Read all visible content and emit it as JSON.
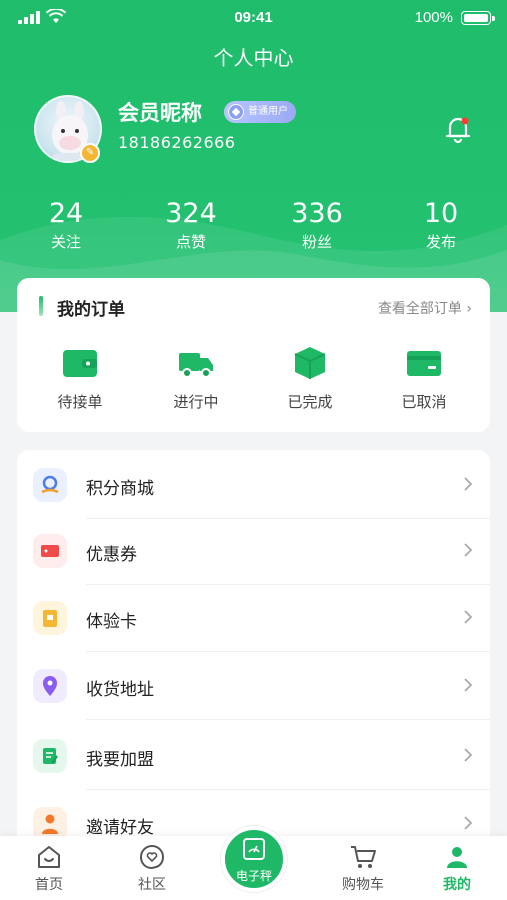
{
  "status_bar": {
    "time": "09:41",
    "battery": "100%"
  },
  "header": {
    "title": "个人中心"
  },
  "profile": {
    "nickname": "会员昵称",
    "badge": "普通用户",
    "phone": "18186262666"
  },
  "stats": [
    {
      "value": "24",
      "label": "关注"
    },
    {
      "value": "324",
      "label": "点赞"
    },
    {
      "value": "336",
      "label": "粉丝"
    },
    {
      "value": "10",
      "label": "发布"
    }
  ],
  "orders": {
    "title": "我的订单",
    "view_all": "查看全部订单 ›",
    "items": [
      {
        "label": "待接单",
        "icon": "wallet-icon"
      },
      {
        "label": "进行中",
        "icon": "truck-icon"
      },
      {
        "label": "已完成",
        "icon": "box-icon"
      },
      {
        "label": "已取消",
        "icon": "card-icon"
      }
    ]
  },
  "menu": [
    {
      "label": "积分商城",
      "icon": "points-mall-icon",
      "color": "#eaf0ff"
    },
    {
      "label": "优惠券",
      "icon": "coupon-icon",
      "color": "#ffecec"
    },
    {
      "label": "体验卡",
      "icon": "trial-card-icon",
      "color": "#fff5dc"
    },
    {
      "label": "收货地址",
      "icon": "location-icon",
      "color": "#f0ebff"
    },
    {
      "label": "我要加盟",
      "icon": "join-icon",
      "color": "#e6f8ee"
    },
    {
      "label": "邀请好友",
      "icon": "invite-icon",
      "color": "#fff0e4"
    }
  ],
  "tabbar": {
    "items": [
      {
        "label": "首页",
        "icon": "home-icon"
      },
      {
        "label": "社区",
        "icon": "community-icon"
      },
      {
        "label": "电子秤",
        "icon": "scale-icon"
      },
      {
        "label": "购物车",
        "icon": "cart-icon"
      },
      {
        "label": "我的",
        "icon": "profile-icon"
      }
    ],
    "active": "我的"
  },
  "colors": {
    "brand_green": "#1fbd6b",
    "notification_dot": "#ff3b30"
  }
}
